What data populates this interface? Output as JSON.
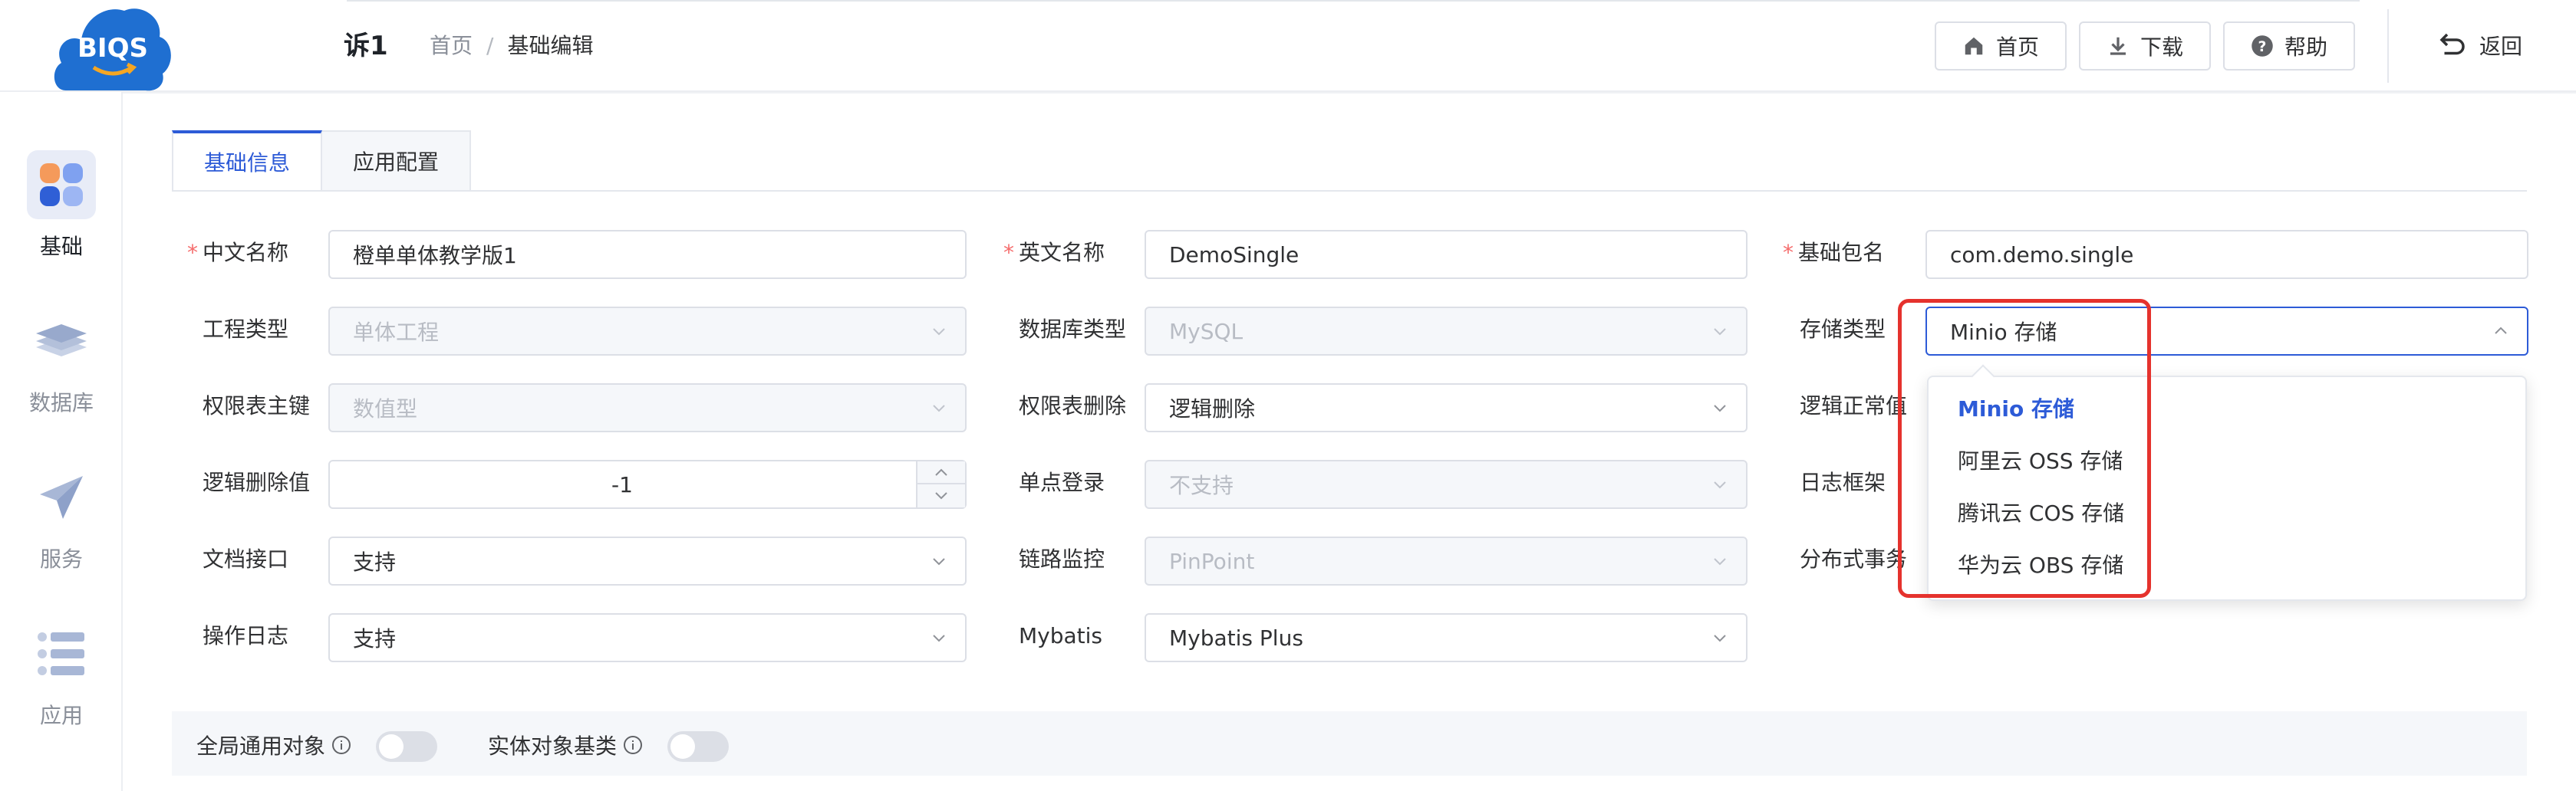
{
  "header": {
    "logo_text": "BIQS",
    "app_title": "诉1",
    "breadcrumb": [
      "首页",
      "基础编辑"
    ],
    "buttons": {
      "home": "首页",
      "download": "下载",
      "help": "帮助"
    },
    "back": "返回"
  },
  "sidebar": {
    "items": [
      {
        "label": "基础",
        "icon": "apps-icon",
        "active": true
      },
      {
        "label": "数据库",
        "icon": "layers-icon"
      },
      {
        "label": "服务",
        "icon": "send-icon"
      },
      {
        "label": "应用",
        "icon": "list-icon"
      }
    ]
  },
  "tabs": [
    "基础信息",
    "应用配置"
  ],
  "form": {
    "cn_name": {
      "label": "中文名称",
      "value": "橙单单体教学版1",
      "required": true
    },
    "en_name": {
      "label": "英文名称",
      "value": "DemoSingle",
      "required": true
    },
    "pkg_name": {
      "label": "基础包名",
      "value": "com.demo.single",
      "required": true
    },
    "project_type": {
      "label": "工程类型",
      "value": "单体工程"
    },
    "db_type": {
      "label": "数据库类型",
      "value": "MySQL"
    },
    "storage_type": {
      "label": "存储类型",
      "value": "Minio 存储"
    },
    "perm_pk": {
      "label": "权限表主键",
      "value": "数值型"
    },
    "perm_delete": {
      "label": "权限表删除",
      "value": "逻辑删除"
    },
    "logic_normal": {
      "label": "逻辑正常值"
    },
    "logic_delete_value": {
      "label": "逻辑删除值",
      "value": "-1"
    },
    "sso": {
      "label": "单点登录",
      "value": "不支持"
    },
    "log_framework": {
      "label": "日志框架"
    },
    "doc_api": {
      "label": "文档接口",
      "value": "支持"
    },
    "tracing": {
      "label": "链路监控",
      "value": "PinPoint"
    },
    "dist_tx": {
      "label": "分布式事务"
    },
    "op_log": {
      "label": "操作日志",
      "value": "支持"
    },
    "mybatis": {
      "label": "Mybatis",
      "value": "Mybatis Plus"
    }
  },
  "switches": {
    "global_object": {
      "label": "全局通用对象",
      "on": false
    },
    "entity_base": {
      "label": "实体对象基类",
      "on": false
    }
  },
  "storage_dropdown": {
    "options": [
      "Minio 存储",
      "阿里云 OSS 存储",
      "腾讯云 COS 存储",
      "华为云 OBS 存储"
    ],
    "selected": "Minio 存储"
  },
  "colors": {
    "accent": "#2d5bd7",
    "required": "#f56c6c",
    "highlight_box": "#e5322d",
    "logo": "#1f6fd1"
  }
}
